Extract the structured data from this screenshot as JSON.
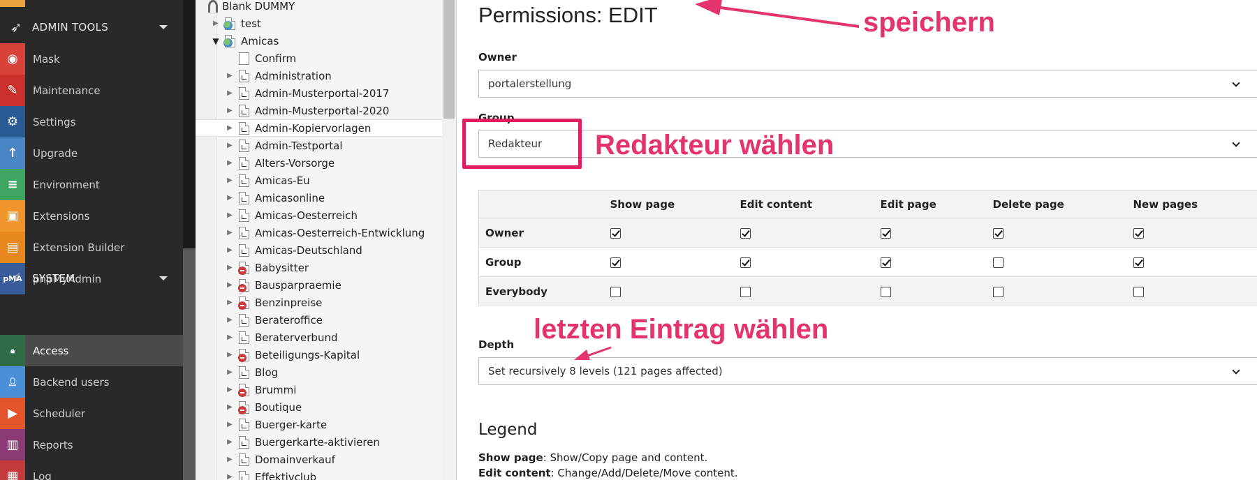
{
  "module_menu": {
    "groups": [
      {
        "label": "ADMIN TOOLS",
        "icon": "rocket-icon"
      },
      {
        "label": "SYSTEM",
        "icon": "plug-icon"
      }
    ],
    "admin_items": [
      {
        "label": "Mask",
        "icon": "mask-icon",
        "color": "#d9413b",
        "glyph": "◉"
      },
      {
        "label": "Maintenance",
        "icon": "wrench-icon",
        "color": "#c9302c",
        "glyph": "✎"
      },
      {
        "label": "Settings",
        "icon": "gears-icon",
        "color": "#2a5a93",
        "glyph": "⚙"
      },
      {
        "label": "Upgrade",
        "icon": "upgrade-icon",
        "color": "#4a86c6",
        "glyph": "↑"
      },
      {
        "label": "Environment",
        "icon": "server-icon",
        "color": "#3ea461",
        "glyph": "≡"
      },
      {
        "label": "Extensions",
        "icon": "box-icon",
        "color": "#f0942c",
        "glyph": "▣"
      },
      {
        "label": "Extension Builder",
        "icon": "builder-icon",
        "color": "#e8871e",
        "glyph": "▤"
      },
      {
        "label": "phpMyAdmin",
        "icon": "phpmyadmin-icon",
        "color": "#3a5b99",
        "glyph": "pMA"
      }
    ],
    "system_items": [
      {
        "label": "Access",
        "icon": "lock-icon",
        "color": "#2f6b47",
        "glyph": "🔒︎",
        "active": true
      },
      {
        "label": "Backend users",
        "icon": "user-icon",
        "color": "#4a90d9",
        "glyph": "👤︎"
      },
      {
        "label": "Scheduler",
        "icon": "scheduler-icon",
        "color": "#e2552b",
        "glyph": "▶"
      },
      {
        "label": "Reports",
        "icon": "reports-icon",
        "color": "#8c3a74",
        "glyph": "▥"
      },
      {
        "label": "Log",
        "icon": "log-icon",
        "color": "#c23a3a",
        "glyph": "▦"
      }
    ]
  },
  "page_tree": {
    "root": "Blank DUMMY",
    "nodes": [
      {
        "label": "test",
        "depth": 1,
        "toggle": "closed",
        "type": "globe"
      },
      {
        "label": "Amicas",
        "depth": 1,
        "toggle": "open",
        "type": "globe"
      },
      {
        "label": "Confirm",
        "depth": 2,
        "toggle": "none",
        "type": "plain"
      },
      {
        "label": "Administration",
        "depth": 2,
        "toggle": "closed",
        "type": "shortcut"
      },
      {
        "label": "Admin-Musterportal-2017",
        "depth": 2,
        "toggle": "closed",
        "type": "shortcut"
      },
      {
        "label": "Admin-Musterportal-2020",
        "depth": 2,
        "toggle": "closed",
        "type": "shortcut"
      },
      {
        "label": "Admin-Kopiervorlagen",
        "depth": 2,
        "toggle": "closed",
        "type": "shortcut",
        "highlight": true
      },
      {
        "label": "Admin-Testportal",
        "depth": 2,
        "toggle": "closed",
        "type": "shortcut"
      },
      {
        "label": "Alters-Vorsorge",
        "depth": 2,
        "toggle": "closed",
        "type": "shortcut"
      },
      {
        "label": "Amicas-Eu",
        "depth": 2,
        "toggle": "closed",
        "type": "shortcut"
      },
      {
        "label": "Amicasonline",
        "depth": 2,
        "toggle": "closed",
        "type": "shortcut"
      },
      {
        "label": "Amicas-Oesterreich",
        "depth": 2,
        "toggle": "closed",
        "type": "shortcut"
      },
      {
        "label": "Amicas-Oesterreich-Entwicklung",
        "depth": 2,
        "toggle": "closed",
        "type": "shortcut"
      },
      {
        "label": "Amicas-Deutschland",
        "depth": 2,
        "toggle": "closed",
        "type": "shortcut"
      },
      {
        "label": "Babysitter",
        "depth": 2,
        "toggle": "closed",
        "type": "disabled"
      },
      {
        "label": "Bausparpraemie",
        "depth": 2,
        "toggle": "closed",
        "type": "disabled"
      },
      {
        "label": "Benzinpreise",
        "depth": 2,
        "toggle": "closed",
        "type": "disabled"
      },
      {
        "label": "Berateroffice",
        "depth": 2,
        "toggle": "closed",
        "type": "shortcut"
      },
      {
        "label": "Beraterverbund",
        "depth": 2,
        "toggle": "closed",
        "type": "shortcut"
      },
      {
        "label": "Beteiligungs-Kapital",
        "depth": 2,
        "toggle": "closed",
        "type": "disabled"
      },
      {
        "label": "Blog",
        "depth": 2,
        "toggle": "closed",
        "type": "shortcut"
      },
      {
        "label": "Brummi",
        "depth": 2,
        "toggle": "closed",
        "type": "disabled"
      },
      {
        "label": "Boutique",
        "depth": 2,
        "toggle": "closed",
        "type": "disabled"
      },
      {
        "label": "Buerger-karte",
        "depth": 2,
        "toggle": "closed",
        "type": "shortcut"
      },
      {
        "label": "Buergerkarte-aktivieren",
        "depth": 2,
        "toggle": "closed",
        "type": "shortcut"
      },
      {
        "label": "Domainverkauf",
        "depth": 2,
        "toggle": "closed",
        "type": "shortcut"
      },
      {
        "label": "Effektivclub",
        "depth": 2,
        "toggle": "closed",
        "type": "shortcut"
      }
    ]
  },
  "main": {
    "title": "Permissions: EDIT",
    "owner_label": "Owner",
    "owner_value": "portalerstellung",
    "group_label": "Group",
    "group_value": "Redakteur",
    "permissions": {
      "columns": [
        "Show page",
        "Edit content",
        "Edit page",
        "Delete page",
        "New pages"
      ],
      "rows": [
        {
          "label": "Owner",
          "values": [
            true,
            true,
            true,
            true,
            true
          ]
        },
        {
          "label": "Group",
          "values": [
            true,
            true,
            true,
            false,
            true
          ]
        },
        {
          "label": "Everybody",
          "values": [
            false,
            false,
            false,
            false,
            false
          ]
        }
      ]
    },
    "depth_label": "Depth",
    "depth_value": "Set recursively 8 levels (121 pages affected)",
    "legend_title": "Legend",
    "legend": [
      {
        "term": "Show page",
        "desc": ": Show/Copy page and content."
      },
      {
        "term": "Edit content",
        "desc": ": Change/Add/Delete/Move content."
      }
    ]
  },
  "annotations": {
    "save": "speichern",
    "group": "Redakteur wählen",
    "depth": "letzten Eintrag wählen",
    "color": "#e5336b"
  }
}
